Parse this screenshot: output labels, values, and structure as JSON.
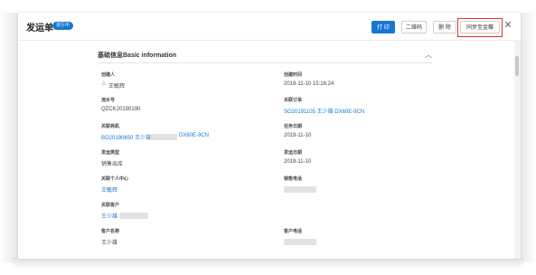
{
  "header": {
    "title": "发运单",
    "status_badge": "进行中",
    "buttons": {
      "print": "打 印",
      "qrcode": "二维码",
      "delete": "删 除",
      "sync": "同步至金蝶"
    },
    "close_icon": "✕"
  },
  "section": {
    "title": "基础信息Basic information",
    "collapse_icon": "chevron-up-icon"
  },
  "fields": {
    "creator_label": "创建人",
    "creator_value": "王敏辉",
    "create_time_label": "创建时间",
    "create_time_value": "2019-11-10 15:16:24",
    "serial_label": "流水号",
    "serial_value": "QZCK20190190",
    "related_order_label": "关联订单",
    "related_order_value": "SO20191105 王少雄 DX60E-9CN",
    "related_opp_label": "关联商机",
    "related_opp_value_a": "BO20190650 王少雄",
    "related_opp_value_b": "DX60E-9CN",
    "task_date_label": "任务日期",
    "task_date_value": "2019-11-10",
    "ship_type_label": "发运类型",
    "ship_type_value": "销售出库",
    "ship_date_label": "发运日期",
    "ship_date_value": "2019-11-10",
    "related_person_label": "关联个人中心",
    "related_person_value": "王敏辉",
    "sales_phone_label": "销售电话",
    "related_customer_label": "关联客户",
    "related_customer_value": "王少雄",
    "customer_name_label": "客户名称",
    "customer_name_value": "王少雄",
    "customer_phone_label": "客户电话"
  }
}
